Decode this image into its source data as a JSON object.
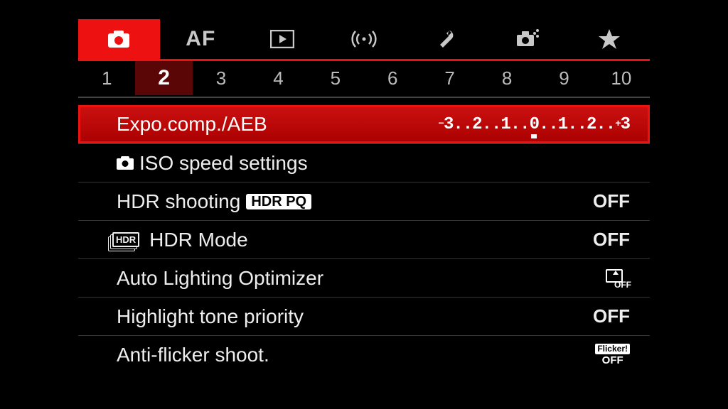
{
  "colors": {
    "accent": "#e11b1b"
  },
  "topTabs": {
    "activeIndex": 0,
    "items": [
      {
        "id": "shoot",
        "icon": "camera-icon"
      },
      {
        "id": "af",
        "label": "AF",
        "icon": "af-icon"
      },
      {
        "id": "playback",
        "icon": "play-icon"
      },
      {
        "id": "wireless",
        "icon": "antenna-icon"
      },
      {
        "id": "setup",
        "icon": "wrench-icon"
      },
      {
        "id": "custom",
        "icon": "custom-camera-icon"
      },
      {
        "id": "mymenu",
        "icon": "star-icon"
      }
    ]
  },
  "pageNumbers": {
    "activeIndex": 1,
    "items": [
      "1",
      "2",
      "3",
      "4",
      "5",
      "6",
      "7",
      "8",
      "9",
      "10"
    ]
  },
  "menu": {
    "selectedIndex": 0,
    "items": [
      {
        "label": "Expo.comp./AEB",
        "valueType": "expo-scale",
        "scale": "⁻3..2..1..0..1..2..⁺3",
        "left": "3..2..1..",
        "right": "..1..2..",
        "centerNum": "0",
        "endR": "3"
      },
      {
        "label": "ISO speed settings",
        "prefixIcon": "camera-small-icon",
        "value": ""
      },
      {
        "label": "HDR shooting",
        "labelBadge": "HDR PQ",
        "value": "OFF"
      },
      {
        "label": "HDR Mode",
        "prefixIcon": "hdr-stack-icon",
        "prefixIconText": "HDR",
        "value": "OFF"
      },
      {
        "label": "Auto Lighting Optimizer",
        "valueIcon": "alo-off-icon",
        "valueIconSub": "OFF"
      },
      {
        "label": "Highlight tone priority",
        "value": "OFF"
      },
      {
        "label": "Anti-flicker shoot.",
        "valueIcon": "flicker-off-icon",
        "valueIconBadge": "Flicker!",
        "valueIconSub": "OFF"
      }
    ]
  }
}
